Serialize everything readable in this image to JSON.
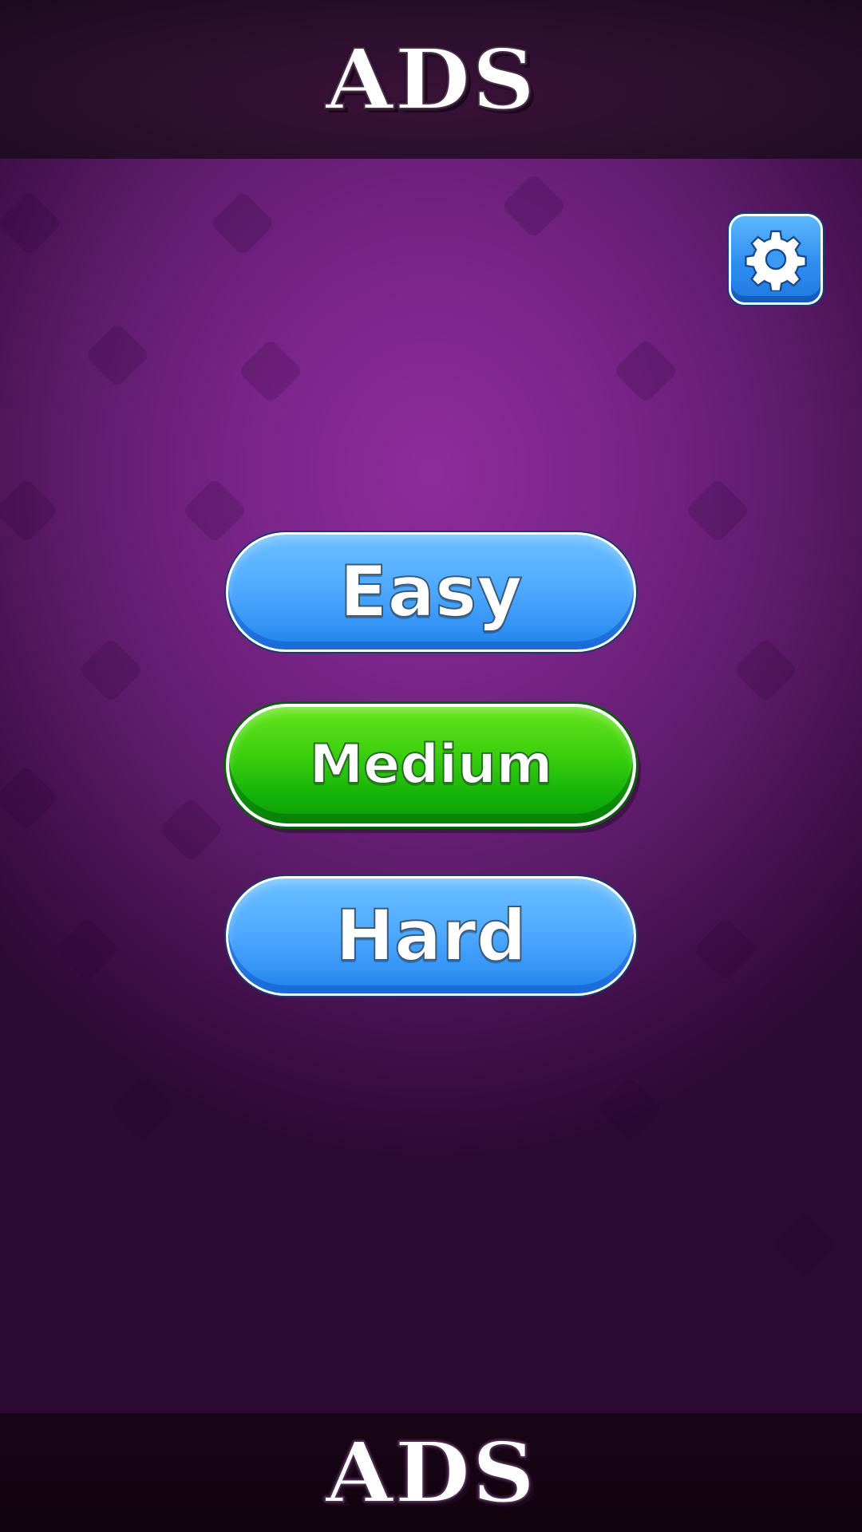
{
  "ads": {
    "top_label": "ADS",
    "bottom_label": "ADS"
  },
  "settings": {
    "icon": "gear-icon"
  },
  "difficulty": {
    "easy_label": "Easy",
    "medium_label": "Medium",
    "hard_label": "Hard",
    "selected": "Medium"
  },
  "colors": {
    "background": "#7a2589",
    "button_blue": "#50aaff",
    "button_green": "#3cd00e",
    "ad_bar": "#2a0f2c"
  }
}
